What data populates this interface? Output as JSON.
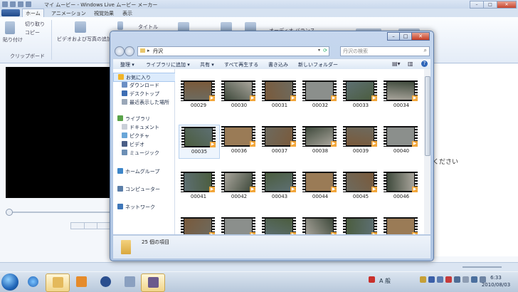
{
  "movie_maker": {
    "title": "マイ ムービー - Windows Live ムービー メーカー",
    "tabs": [
      "ホーム",
      "アニメーション",
      "視覚効果",
      "表示"
    ],
    "ribbon": {
      "paste": "貼り付け",
      "cut": "切り取り",
      "copy": "コピー",
      "clipboard_group": "クリップボード",
      "add_video_photo": "ビデオおよび写真の追加",
      "title_btn": "タイトル",
      "audio_mix": "オーディオ バランス"
    },
    "storyboard_partial": "ください"
  },
  "explorer": {
    "address_path": "丹沢",
    "search_placeholder": "丹沢の検索",
    "commands": [
      "整理 ▾",
      "ライブラリに追加 ▾",
      "共有 ▾",
      "すべて再生する",
      "書き込み",
      "新しいフォルダー"
    ],
    "nav": [
      {
        "label": "お気に入り",
        "icon": "star-icon",
        "color": "#f0b429"
      },
      {
        "label": "ダウンロード",
        "icon": "download-folder-icon",
        "color": "#6b8fc4"
      },
      {
        "label": "デスクトップ",
        "icon": "desktop-icon",
        "color": "#3d6db3"
      },
      {
        "label": "最近表示した場所",
        "icon": "recent-places-icon",
        "color": "#9aa7b8"
      },
      {
        "label": "ライブラリ",
        "icon": "libraries-icon",
        "color": "#5aa34a"
      },
      {
        "label": "ドキュメント",
        "icon": "documents-icon",
        "color": "#c9cfd8"
      },
      {
        "label": "ピクチャ",
        "icon": "pictures-icon",
        "color": "#6aa6d8"
      },
      {
        "label": "ビデオ",
        "icon": "videos-icon",
        "color": "#4b5f86"
      },
      {
        "label": "ミュージック",
        "icon": "music-icon",
        "color": "#6d8fb5"
      },
      {
        "label": "ホームグループ",
        "icon": "homegroup-icon",
        "color": "#3d86c9"
      },
      {
        "label": "コンピューター",
        "icon": "computer-icon",
        "color": "#5b7ea8"
      },
      {
        "label": "ネットワーク",
        "icon": "network-icon",
        "color": "#3f77b9"
      }
    ],
    "files": [
      "00029",
      "00030",
      "00031",
      "00032",
      "00033",
      "00034",
      "00035",
      "00036",
      "00037",
      "00038",
      "00039",
      "00040",
      "00041",
      "00042",
      "00043",
      "00044",
      "00045",
      "00046",
      "",
      "",
      "",
      "",
      "",
      ""
    ],
    "selected_file": "00035",
    "item_count": "25 個の項目"
  },
  "taskbar": {
    "ime": "A 般",
    "time": "6:33",
    "date": "2010/08/03"
  }
}
